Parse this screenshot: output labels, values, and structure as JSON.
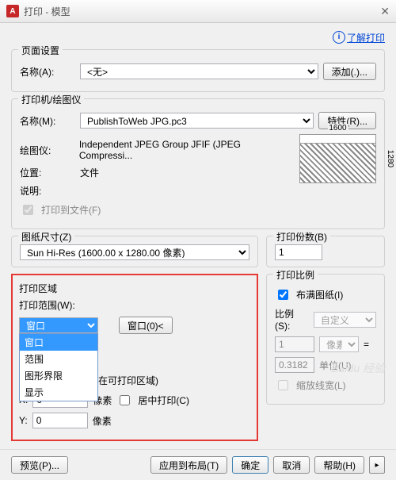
{
  "title": "打印 - 模型",
  "learn_link": "了解打印",
  "page_setup": {
    "title": "页面设置",
    "name_label": "名称(A):",
    "name_value": "<无>",
    "add_btn": "添加(.)..."
  },
  "printer": {
    "title": "打印机/绘图仪",
    "name_label": "名称(M):",
    "name_value": "PublishToWeb JPG.pc3",
    "props_btn": "特性(R)...",
    "plotter_label": "绘图仪:",
    "plotter_value": "Independent JPEG Group JFIF (JPEG Compressi...",
    "where_label": "位置:",
    "where_value": "文件",
    "desc_label": "说明:",
    "tofile": "打印到文件(F)",
    "preview_w": "1600",
    "preview_h": "1280"
  },
  "paper": {
    "title": "图纸尺寸(Z)",
    "value": "Sun Hi-Res (1600.00 x 1280.00 像素)"
  },
  "copies": {
    "title": "打印份数(B)",
    "value": "1"
  },
  "area": {
    "title": "打印区域",
    "range_label": "打印范围(W):",
    "selected": "窗口",
    "options": [
      "窗口",
      "范围",
      "图形界限",
      "显示"
    ],
    "window_btn": "窗口(0)<",
    "offset_title": "打印偏移(原点设置在可打印区域)",
    "x_label": "X:",
    "x_value": "0",
    "y_label": "Y:",
    "y_value": "0",
    "unit": "像素",
    "center": "居中打印(C)"
  },
  "scale": {
    "title": "打印比例",
    "fit": "布满图纸(I)",
    "ratio_label": "比例(S):",
    "ratio_value": "自定义",
    "unit1_value": "1",
    "unit1_label": "像素",
    "unit2_value": "0.3182",
    "unit2_label": "单位(U)",
    "lineweights": "缩放线宽(L)"
  },
  "footer": {
    "preview": "预览(P)...",
    "apply": "应用到布局(T)",
    "ok": "确定",
    "cancel": "取消",
    "help": "帮助(H)"
  },
  "watermark": "Baidu 经验"
}
